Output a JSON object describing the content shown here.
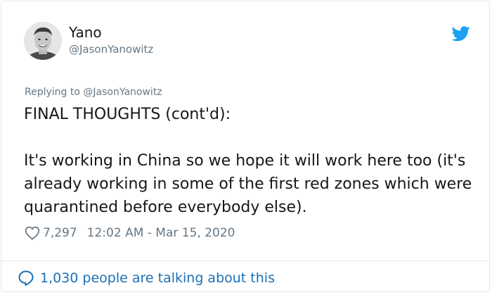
{
  "author": {
    "display_name": "Yano",
    "handle": "@JasonYanowitz",
    "avatar_icon": "user-avatar-photo"
  },
  "brand_icon": "twitter-bird-icon",
  "reply_context": {
    "prefix": "Replying to ",
    "mention": "@JasonYanowitz"
  },
  "tweet": {
    "lines": [
      "FINAL THOUGHTS (cont'd):",
      "It's working in China so we hope it will work here too (it's already working in some of the first red zones which were quarantined before everybody else)."
    ]
  },
  "meta": {
    "likes": "7,297",
    "timestamp": "12:02 AM - Mar 15, 2020"
  },
  "footer": {
    "talking_text": "1,030 people are talking about this"
  },
  "colors": {
    "text": "#14171a",
    "secondary": "#657786",
    "link": "#1b6fb5",
    "twitter_blue": "#1da1f2",
    "border": "#e1e8ed"
  }
}
